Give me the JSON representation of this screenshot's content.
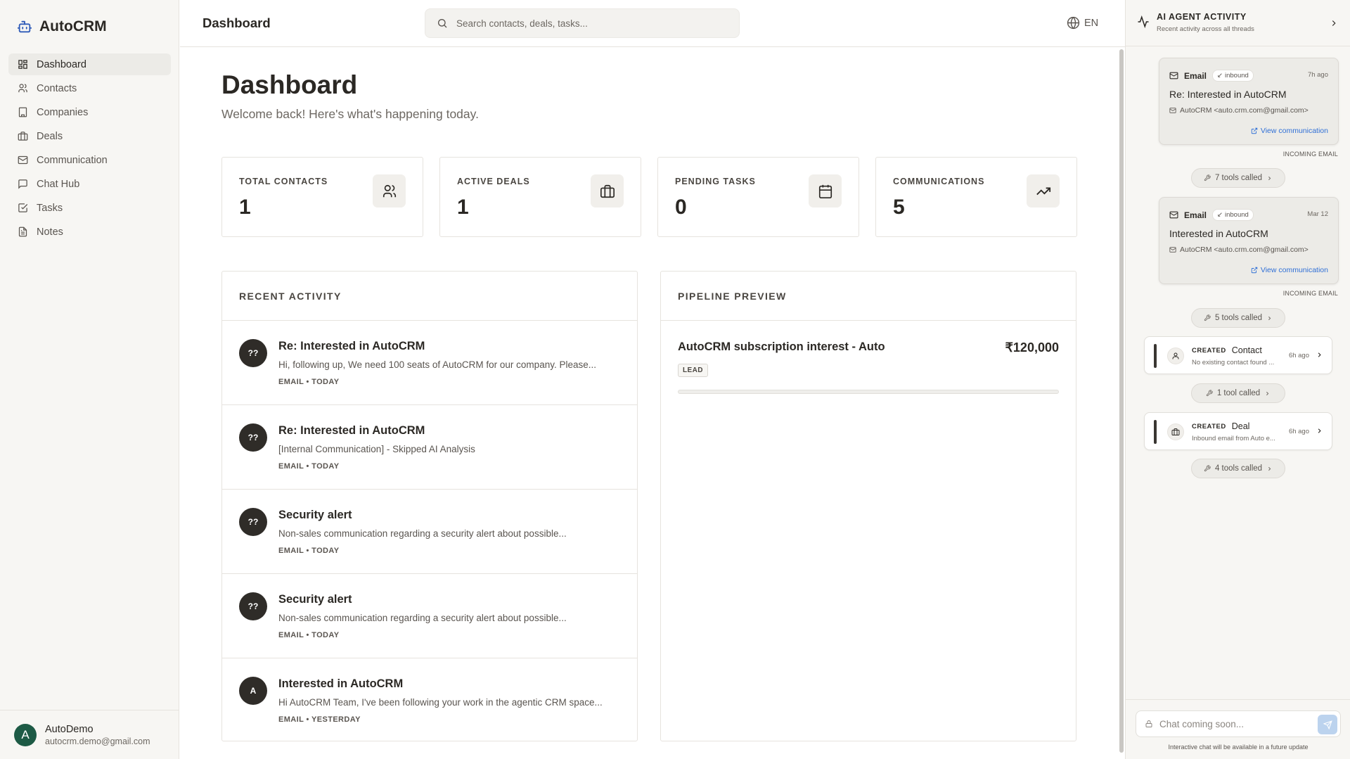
{
  "app": {
    "name": "AutoCRM"
  },
  "sidebar": {
    "items": [
      {
        "label": "Dashboard",
        "icon": "dashboard-icon",
        "active": true
      },
      {
        "label": "Contacts",
        "icon": "users-icon"
      },
      {
        "label": "Companies",
        "icon": "building-icon"
      },
      {
        "label": "Deals",
        "icon": "briefcase-icon"
      },
      {
        "label": "Communication",
        "icon": "mail-icon"
      },
      {
        "label": "Chat Hub",
        "icon": "message-square-icon"
      },
      {
        "label": "Tasks",
        "icon": "check-square-icon"
      },
      {
        "label": "Notes",
        "icon": "file-text-icon"
      }
    ],
    "user": {
      "initial": "A",
      "name": "AutoDemo",
      "email": "autocrm.demo@gmail.com"
    }
  },
  "topbar": {
    "title": "Dashboard",
    "search_placeholder": "Search contacts, deals, tasks...",
    "language": "EN"
  },
  "main": {
    "title": "Dashboard",
    "subtitle": "Welcome back! Here's what's happening today.",
    "stats": [
      {
        "label": "TOTAL CONTACTS",
        "value": "1",
        "icon": "users-icon"
      },
      {
        "label": "ACTIVE DEALS",
        "value": "1",
        "icon": "briefcase-icon"
      },
      {
        "label": "PENDING TASKS",
        "value": "0",
        "icon": "calendar-icon"
      },
      {
        "label": "COMMUNICATIONS",
        "value": "5",
        "icon": "trending-up-icon"
      }
    ],
    "recent_activity": {
      "title": "RECENT ACTIVITY",
      "items": [
        {
          "avatar": "??",
          "title": "Re: Interested in AutoCRM",
          "body": "Hi, following up, We need 100 seats of AutoCRM for our company. Please...",
          "meta": "EMAIL • TODAY"
        },
        {
          "avatar": "??",
          "title": "Re: Interested in AutoCRM",
          "body": "[Internal Communication] - Skipped AI Analysis",
          "meta": "EMAIL • TODAY"
        },
        {
          "avatar": "??",
          "title": "Security alert",
          "body": "Non-sales communication regarding a security alert about possible...",
          "meta": "EMAIL • TODAY"
        },
        {
          "avatar": "??",
          "title": "Security alert",
          "body": "Non-sales communication regarding a security alert about possible...",
          "meta": "EMAIL • TODAY"
        },
        {
          "avatar": "A",
          "title": "Interested in AutoCRM",
          "body": "Hi AutoCRM Team, I've been following your work in the agentic CRM space...",
          "meta": "EMAIL • YESTERDAY"
        }
      ]
    },
    "pipeline": {
      "title": "PIPELINE PREVIEW",
      "deals": [
        {
          "name": "AutoCRM subscription interest - Auto",
          "value": "₹120,000",
          "stage": "LEAD",
          "progress": 0
        }
      ]
    }
  },
  "agent_panel": {
    "title": "AI AGENT ACTIVITY",
    "subtitle": "Recent activity across all threads",
    "emails": [
      {
        "type": "Email",
        "direction": "inbound",
        "time": "7h ago",
        "subject": "Re: Interested in AutoCRM",
        "from": "AutoCRM <auto.crm.com@gmail.com>",
        "link": "View communication",
        "tag": "INCOMING EMAIL"
      },
      {
        "type": "Email",
        "direction": "inbound",
        "time": "Mar 12",
        "subject": "Interested in AutoCRM",
        "from": "AutoCRM <auto.crm.com@gmail.com>",
        "link": "View communication",
        "tag": "INCOMING EMAIL"
      }
    ],
    "tools": [
      "7 tools called",
      "5 tools called",
      "1 tool called",
      "4 tools called"
    ],
    "created": [
      {
        "verb": "CREATED",
        "entity": "Contact",
        "desc": "No existing contact found ...",
        "time": "6h ago",
        "icon": "user-icon"
      },
      {
        "verb": "CREATED",
        "entity": "Deal",
        "desc": "Inbound email from Auto e...",
        "time": "6h ago",
        "icon": "briefcase-icon"
      }
    ],
    "chat_placeholder": "Chat coming soon...",
    "chat_note": "Interactive chat will be available in a future update"
  }
}
